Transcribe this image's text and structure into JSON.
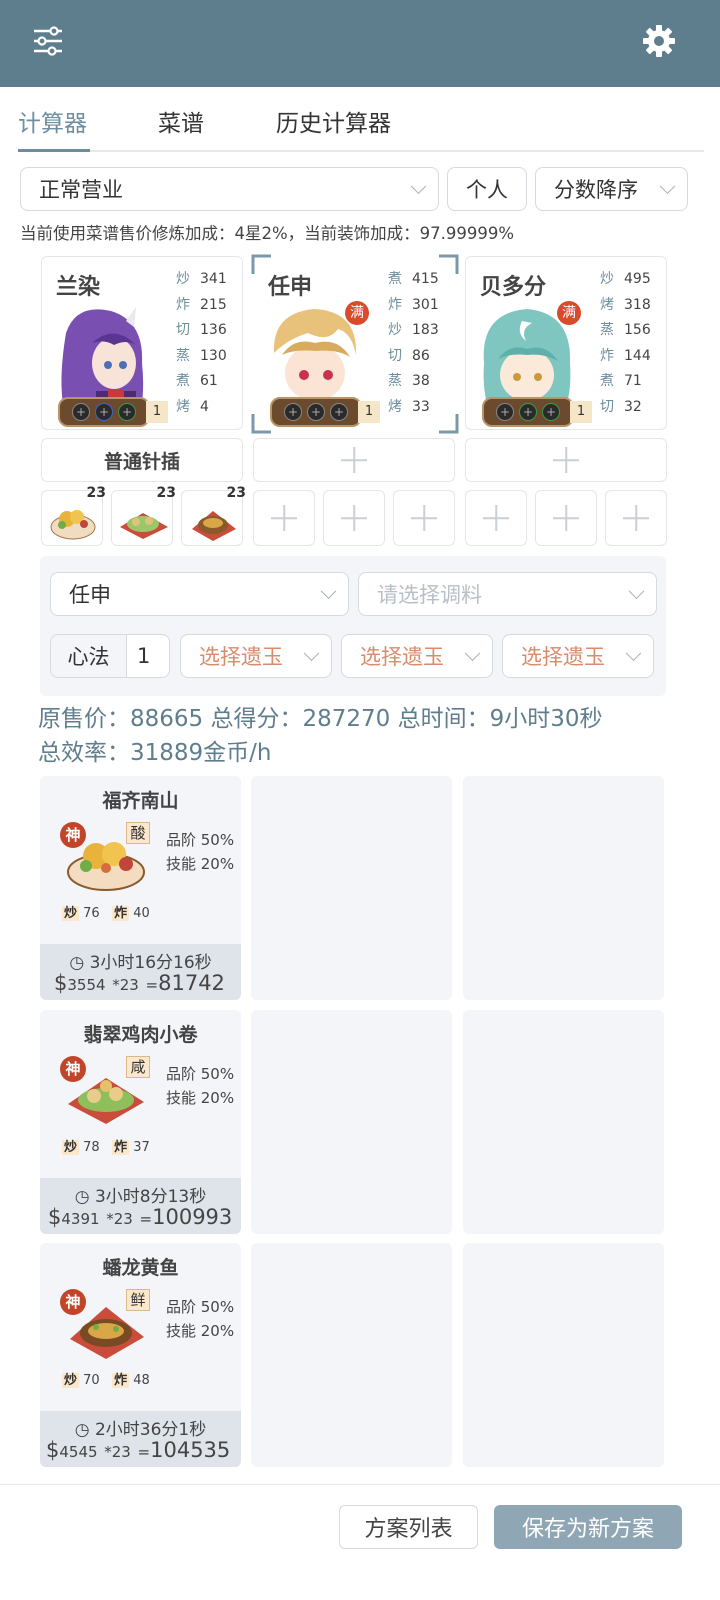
{
  "header": {
    "menu_icon": "sliders-icon",
    "settings_icon": "gear-icon"
  },
  "tabs": [
    "计算器",
    "菜谱",
    "历史计算器"
  ],
  "filters": {
    "mode": "正常营业",
    "scope": "个人",
    "sort": "分数降序"
  },
  "bonus_text": "当前使用菜谱售价修炼加成：4星2%，当前装饰加成：97.99999%",
  "chefs": [
    {
      "name": "兰染",
      "full": false,
      "rank": "1",
      "skills": [
        [
          "炒",
          "341"
        ],
        [
          "炸",
          "215"
        ],
        [
          "切",
          "136"
        ],
        [
          "蒸",
          "130"
        ],
        [
          "煮",
          "61"
        ],
        [
          "烤",
          "4"
        ]
      ]
    },
    {
      "name": "任申",
      "full": true,
      "rank": "1",
      "skills": [
        [
          "煮",
          "415"
        ],
        [
          "炸",
          "301"
        ],
        [
          "炒",
          "183"
        ],
        [
          "切",
          "86"
        ],
        [
          "蒸",
          "38"
        ],
        [
          "烤",
          "33"
        ]
      ]
    },
    {
      "name": "贝多分",
      "full": true,
      "rank": "1",
      "skills": [
        [
          "炒",
          "495"
        ],
        [
          "烤",
          "318"
        ],
        [
          "蒸",
          "156"
        ],
        [
          "炸",
          "144"
        ],
        [
          "煮",
          "71"
        ],
        [
          "切",
          "32"
        ]
      ]
    }
  ],
  "full_label": "满",
  "equip_label": "普通针插",
  "dish_counts": [
    "23",
    "23",
    "23"
  ],
  "panel": {
    "chef_select": "任申",
    "seasoning_placeholder": "请选择调料",
    "xinfa_label": "心法",
    "xinfa_value": "1",
    "jade_placeholder": "选择遗玉"
  },
  "summary": {
    "line1": "原售价：88665 总得分：287270 总时间：9小时30秒",
    "line2": "总效率：31889金币/h"
  },
  "recipes": [
    {
      "name": "福齐南山",
      "god": "神",
      "flavor": "酸",
      "quality": "品阶 50%",
      "skill": "技能 20%",
      "s1k": "炒",
      "s1v": "76",
      "s2k": "炸",
      "s2v": "40",
      "time": "3小时16分16秒",
      "price": "3554",
      "mult": "*23",
      "total": "81742"
    },
    {
      "name": "翡翠鸡肉小卷",
      "god": "神",
      "flavor": "咸",
      "quality": "品阶 50%",
      "skill": "技能 20%",
      "s1k": "炒",
      "s1v": "78",
      "s2k": "炸",
      "s2v": "37",
      "time": "3小时8分13秒",
      "price": "4391",
      "mult": "*23",
      "total": "100993"
    },
    {
      "name": "蟠龙黄鱼",
      "god": "神",
      "flavor": "鲜",
      "quality": "品阶 50%",
      "skill": "技能 20%",
      "s1k": "炒",
      "s1v": "70",
      "s2k": "炸",
      "s2v": "48",
      "time": "2小时36分1秒",
      "price": "4545",
      "mult": "*23",
      "total": "104535"
    }
  ],
  "footer": {
    "list_button": "方案列表",
    "save_button": "保存为新方案"
  }
}
